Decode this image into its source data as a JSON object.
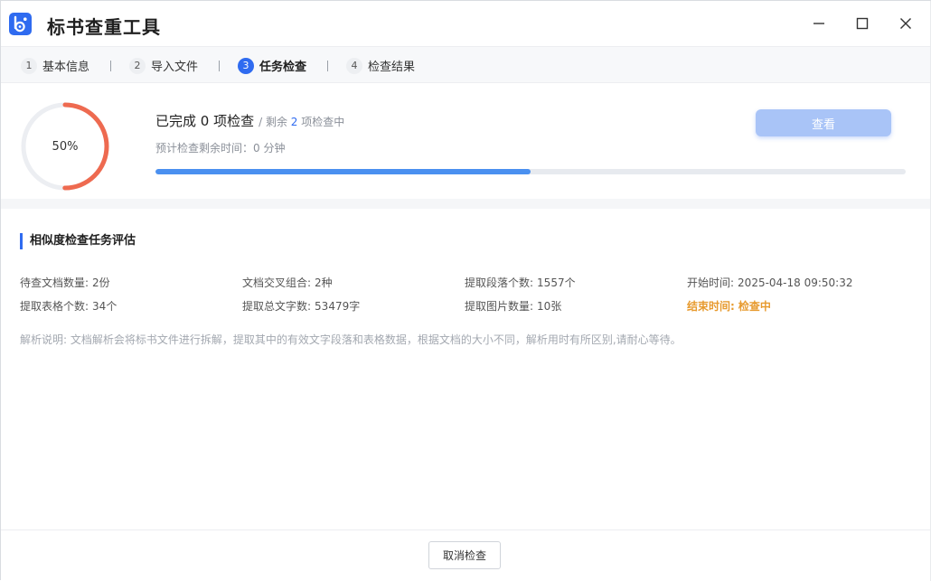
{
  "app": {
    "title": "标书查重工具",
    "accent": "#2f6bf0"
  },
  "window_controls": {
    "minimize_icon": "minimize-icon",
    "maximize_icon": "maximize-icon",
    "close_icon": "close-icon"
  },
  "steps": [
    {
      "num": "1",
      "label": "基本信息",
      "active": false
    },
    {
      "num": "2",
      "label": "导入文件",
      "active": false
    },
    {
      "num": "3",
      "label": "任务检查",
      "active": true
    },
    {
      "num": "4",
      "label": "检查结果",
      "active": false
    }
  ],
  "progress": {
    "percent_label": "50%",
    "ring_fraction": 0.5,
    "ring_color": "#ee6a50",
    "completed_text": "已完成 0 项检查",
    "remaining_prefix": "/ 剩余",
    "remaining_count": "2",
    "remaining_suffix": "项检查中",
    "eta_label": "预计检查剩余时间：",
    "eta_value": "0 分钟",
    "bar_fraction": 0.5,
    "view_button_label": "查看"
  },
  "evaluation": {
    "title": "相似度检查任务评估",
    "items": [
      {
        "key": "待查文档数量:",
        "value": "2份"
      },
      {
        "key": "文档交叉组合:",
        "value": "2种"
      },
      {
        "key": "提取段落个数:",
        "value": "1557个"
      },
      {
        "key": "开始时间:",
        "value": "2025-04-18 09:50:32"
      },
      {
        "key": "提取表格个数:",
        "value": "34个"
      },
      {
        "key": "提取总文字数:",
        "value": "53479字"
      },
      {
        "key": "提取图片数量:",
        "value": "10张"
      },
      {
        "key": "结束时间:",
        "value": "检查中",
        "color": "#e79a2e"
      }
    ],
    "note": "解析说明: 文档解析会将标书文件进行拆解，提取其中的有效文字段落和表格数据，根据文档的大小不同，解析用时有所区别,请耐心等待。"
  },
  "footer": {
    "cancel_label": "取消检查"
  }
}
